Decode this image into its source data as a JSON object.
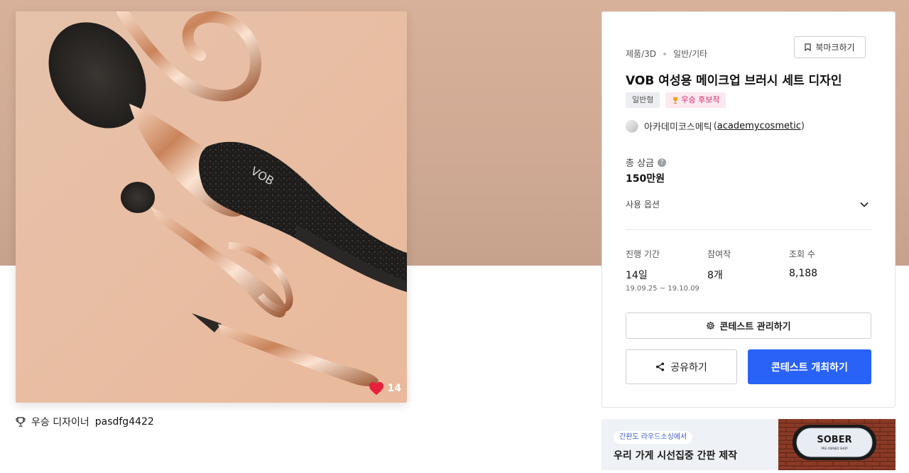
{
  "hero": {
    "background_color": "#d0a995"
  },
  "product_image": {
    "alt": "VOB makeup brush set",
    "brand_mark": "VOB",
    "likes": "14"
  },
  "winner": {
    "label": "우승 디자이너",
    "designer": "pasdfg4422"
  },
  "panel": {
    "category_primary": "제품/3D",
    "category_secondary": "일반/기타",
    "bookmark_label": "북마크하기",
    "title": "VOB 여성용 메이크업 브러시 세트 디자인",
    "tags": {
      "type": "일반형",
      "winner_candidate": "우승 후보작"
    },
    "host_name": "아카데미코스메틱",
    "host_handle_open": "(",
    "host_handle": "academycosmetic",
    "host_handle_close": ")",
    "prize_label": "총 상금",
    "prize_help": "?",
    "prize_value": "150만원",
    "options_label": "사용 옵션",
    "stats": {
      "period_label": "진행 기간",
      "period_value": "14일",
      "period_range": "19.09.25 ~ 19.10.09",
      "entries_label": "참여작",
      "entries_value": "8개",
      "views_label": "조회 수",
      "views_value": "8,188"
    },
    "manage_label": "콘테스트 관리하기",
    "share_label": "공유하기",
    "host_contest_label": "콘테스트 개최하기",
    "accent_color": "#2962f6"
  },
  "ad": {
    "pill": "간판도 라우드소싱에서",
    "headline": "우리 가게 시선집중 간판 제작",
    "sign_text": "SOBER",
    "sign_subtext": "PRE-OWNED SHOP"
  }
}
